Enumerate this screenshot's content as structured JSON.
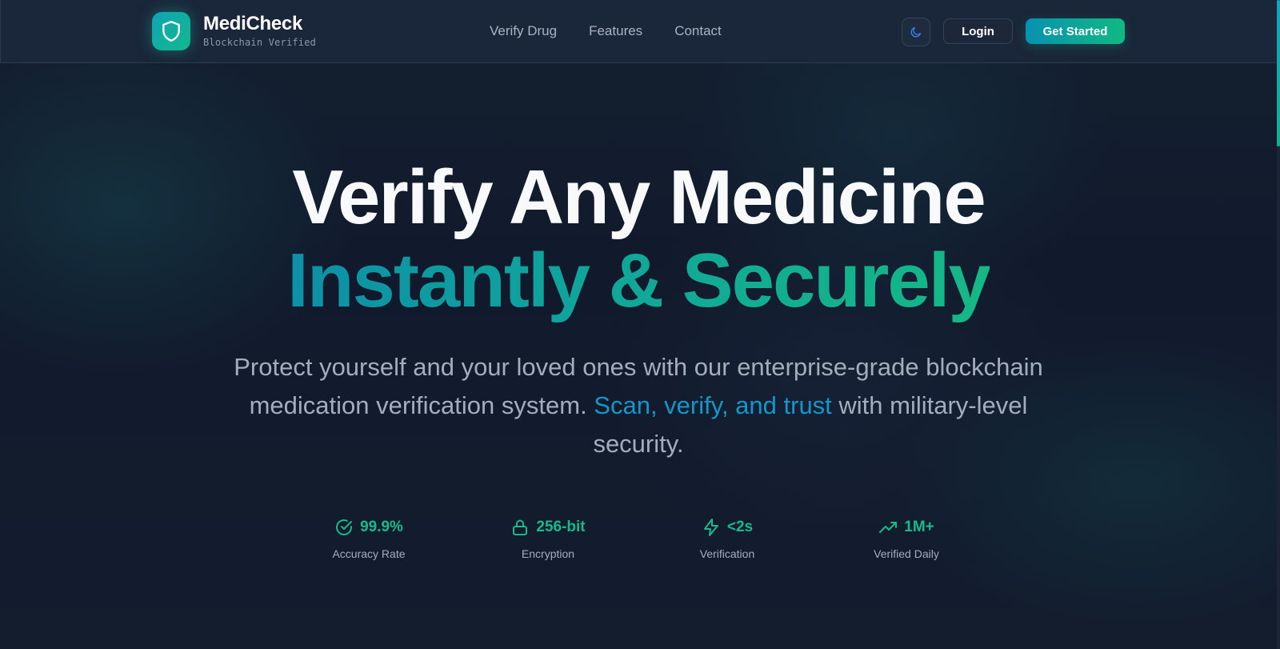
{
  "brand": {
    "name": "MediCheck",
    "tagline": "Blockchain Verified",
    "logo_icon": "shield-icon"
  },
  "nav": {
    "links": [
      {
        "label": "Verify Drug"
      },
      {
        "label": "Features"
      },
      {
        "label": "Contact"
      }
    ],
    "theme_toggle_icon": "moon-icon",
    "login_label": "Login",
    "cta_label": "Get Started"
  },
  "hero": {
    "title_line1": "Verify Any Medicine",
    "title_line2": "Instantly & Securely",
    "desc_part1": "Protect yourself and your loved ones with our enterprise-grade blockchain medication verification system. ",
    "desc_highlight": "Scan, verify, and trust",
    "desc_part2": " with military-level security."
  },
  "stats": [
    {
      "icon": "check-circle-icon",
      "value": "99.9%",
      "label": "Accuracy Rate"
    },
    {
      "icon": "lock-icon",
      "value": "256-bit",
      "label": "Encryption"
    },
    {
      "icon": "lightning-icon",
      "value": "<2s",
      "label": "Verification"
    },
    {
      "icon": "trending-up-icon",
      "value": "1M+",
      "label": "Verified Daily"
    }
  ],
  "colors": {
    "background": "#111a2b",
    "navbar": "#1a2639",
    "accent_teal": "#18b98c",
    "accent_blue": "#1496c8",
    "gradient_start": "#0891b2",
    "gradient_end": "#10b981"
  }
}
